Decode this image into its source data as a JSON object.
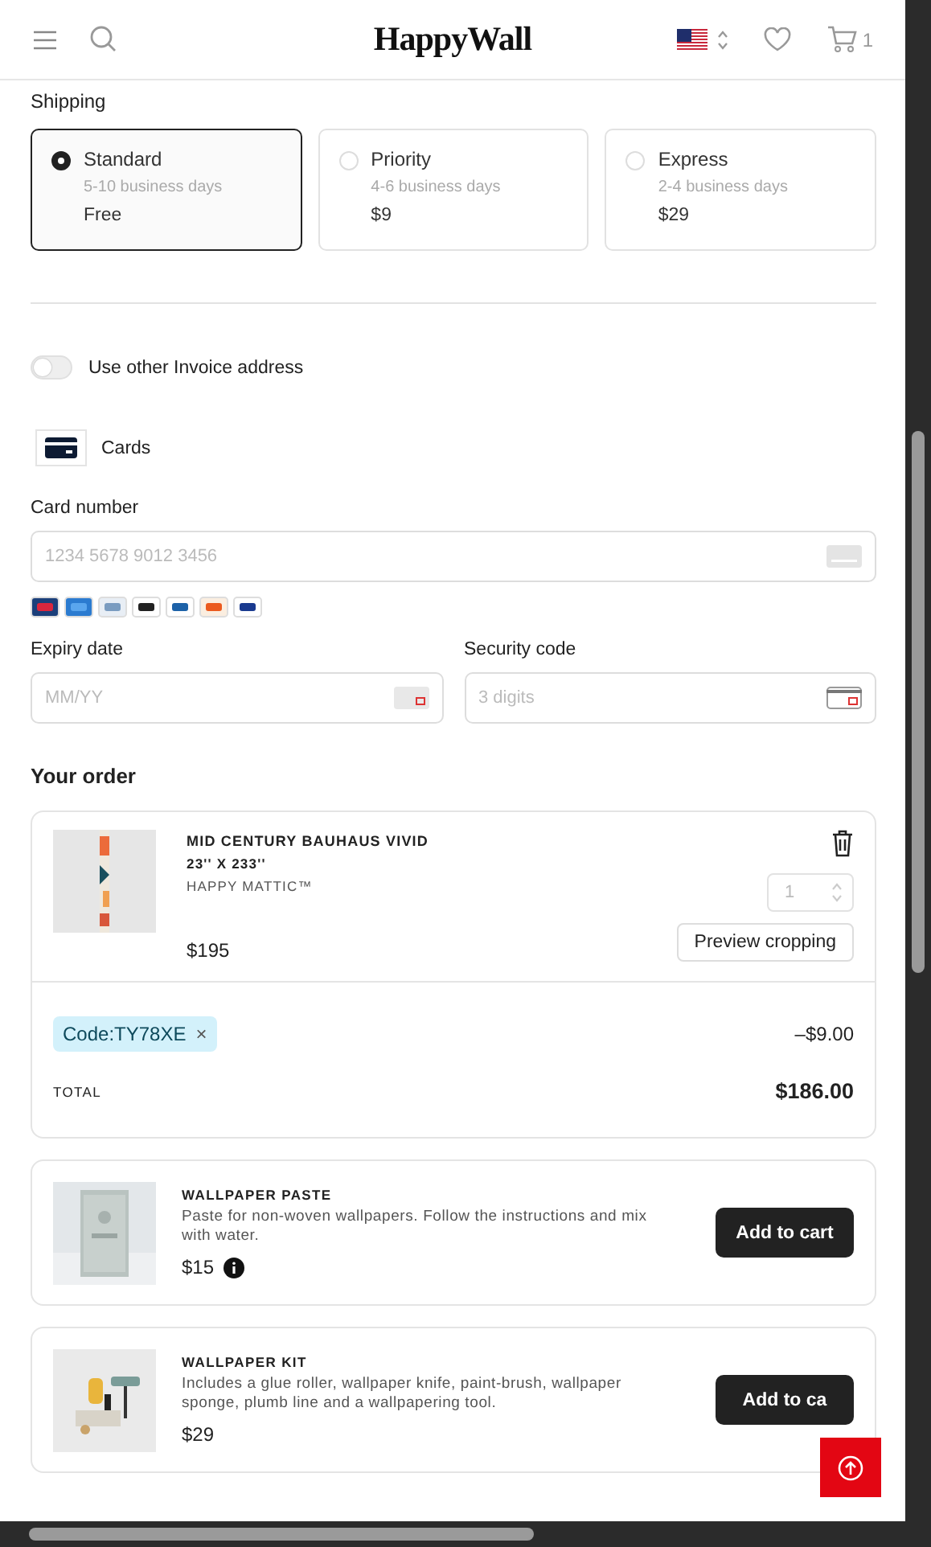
{
  "header": {
    "logo": "HappyWall",
    "cart_count": "1"
  },
  "shipping": {
    "label": "Shipping",
    "options": [
      {
        "name": "Standard",
        "time": "5-10 business days",
        "price": "Free",
        "selected": true
      },
      {
        "name": "Priority",
        "time": "4-6 business days",
        "price": "$9",
        "selected": false
      },
      {
        "name": "Express",
        "time": "2-4 business days",
        "price": "$29",
        "selected": false
      }
    ]
  },
  "invoice_toggle": {
    "label": "Use other Invoice address",
    "on": false
  },
  "payment": {
    "method": "Cards",
    "card_number": {
      "label": "Card number",
      "placeholder": "1234 5678 9012 3456"
    },
    "expiry": {
      "label": "Expiry date",
      "placeholder": "MM/YY"
    },
    "security": {
      "label": "Security code",
      "placeholder": "3 digits"
    }
  },
  "order": {
    "title": "Your order",
    "items": [
      {
        "name": "MID CENTURY BAUHAUS VIVID",
        "size": "23'' X 233''",
        "brand": "HAPPY MATTIC™",
        "price": "$195",
        "quantity": "1",
        "button": "Preview cropping"
      }
    ],
    "discount": {
      "code": "Code:TY78XE",
      "remove": "×",
      "amount": "–$9.00"
    },
    "total": {
      "label": "TOTAL",
      "value": "$186.00"
    }
  },
  "addons": [
    {
      "name": "WALLPAPER PASTE",
      "description": "Paste for non-woven wallpapers. Follow the instructions and mix with water.",
      "price": "$15",
      "info": true,
      "button": "Add to cart"
    },
    {
      "name": "WALLPAPER KIT",
      "description": "Includes a glue roller, wallpaper knife, paint-brush, wallpaper sponge, plumb line and a wallpapering tool.",
      "price": "$29",
      "info": false,
      "button": "Add to ca"
    }
  ]
}
